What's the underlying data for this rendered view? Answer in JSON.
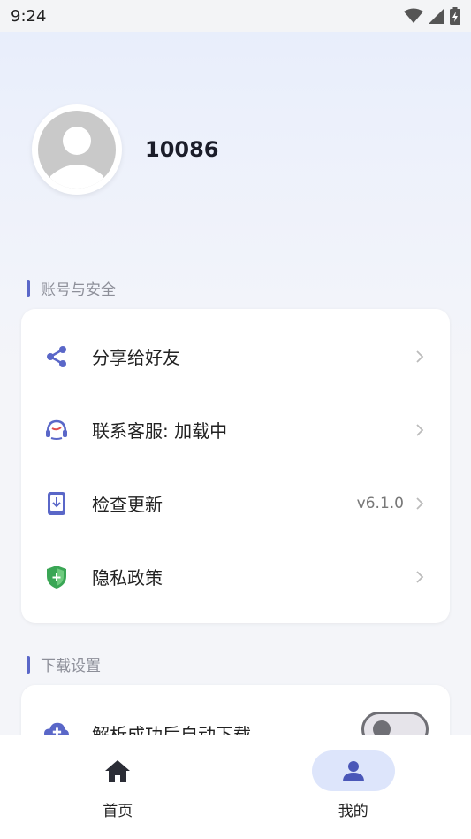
{
  "status_bar": {
    "time": "9:24"
  },
  "profile": {
    "username": "10086"
  },
  "sections": [
    {
      "title": "账号与安全",
      "items": [
        {
          "label": "分享给好友",
          "value": "",
          "icon": "share-icon"
        },
        {
          "label": "联系客服: 加载中",
          "value": "",
          "icon": "customer-service-icon"
        },
        {
          "label": "检查更新",
          "value": "v6.1.0",
          "icon": "update-icon"
        },
        {
          "label": "隐私政策",
          "value": "",
          "icon": "shield-icon"
        }
      ]
    },
    {
      "title": "下载设置",
      "items": [
        {
          "label": "解析成功后自动下载",
          "toggle": false,
          "icon": "download-icon"
        }
      ]
    }
  ],
  "nav": [
    {
      "label": "首页",
      "icon": "home-icon",
      "active": false
    },
    {
      "label": "我的",
      "icon": "person-icon",
      "active": true
    }
  ],
  "colors": {
    "accent": "#5a67c8",
    "shield_green": "#3aa655"
  }
}
